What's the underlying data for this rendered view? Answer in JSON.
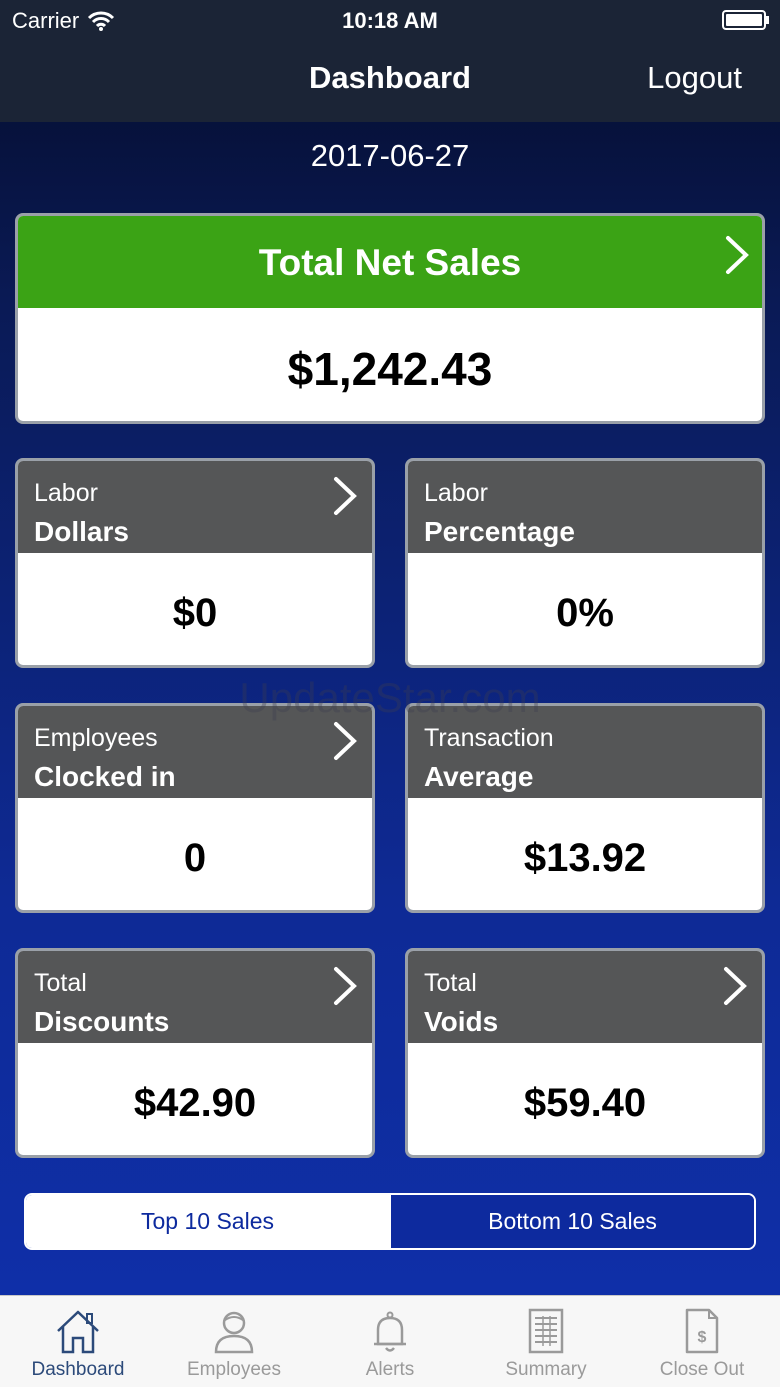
{
  "status": {
    "carrier": "Carrier",
    "time": "10:18 AM"
  },
  "nav": {
    "title": "Dashboard",
    "logout": "Logout"
  },
  "date": "2017-06-27",
  "total_net_sales": {
    "title": "Total Net Sales",
    "value": "$1,242.43"
  },
  "cards": [
    {
      "line1": "Labor",
      "line2": "Dollars",
      "value": "$0",
      "chevron": true
    },
    {
      "line1": "Labor",
      "line2": "Percentage",
      "value": "0%",
      "chevron": false
    },
    {
      "line1": "Employees",
      "line2": "Clocked in",
      "value": "0",
      "chevron": true
    },
    {
      "line1": "Transaction",
      "line2": "Average",
      "value": "$13.92",
      "chevron": false
    },
    {
      "line1": "Total",
      "line2": "Discounts",
      "value": "$42.90",
      "chevron": true
    },
    {
      "line1": "Total",
      "line2": "Voids",
      "value": "$59.40",
      "chevron": true
    }
  ],
  "segment": {
    "top": "Top 10 Sales",
    "bottom": "Bottom 10 Sales",
    "selected": "Top 10 Sales"
  },
  "tabs": [
    {
      "label": "Dashboard",
      "icon": "home-icon",
      "active": true
    },
    {
      "label": "Employees",
      "icon": "person-icon",
      "active": false
    },
    {
      "label": "Alerts",
      "icon": "bell-icon",
      "active": false
    },
    {
      "label": "Summary",
      "icon": "document-icon",
      "active": false
    },
    {
      "label": "Close Out",
      "icon": "dollar-file-icon",
      "active": false
    }
  ],
  "watermark": "UpdateStar.com",
  "colors": {
    "green": "#3ba315",
    "header_gray": "#555657",
    "nav_bg": "#1b2436",
    "accent_blue": "#0d2a9e"
  }
}
